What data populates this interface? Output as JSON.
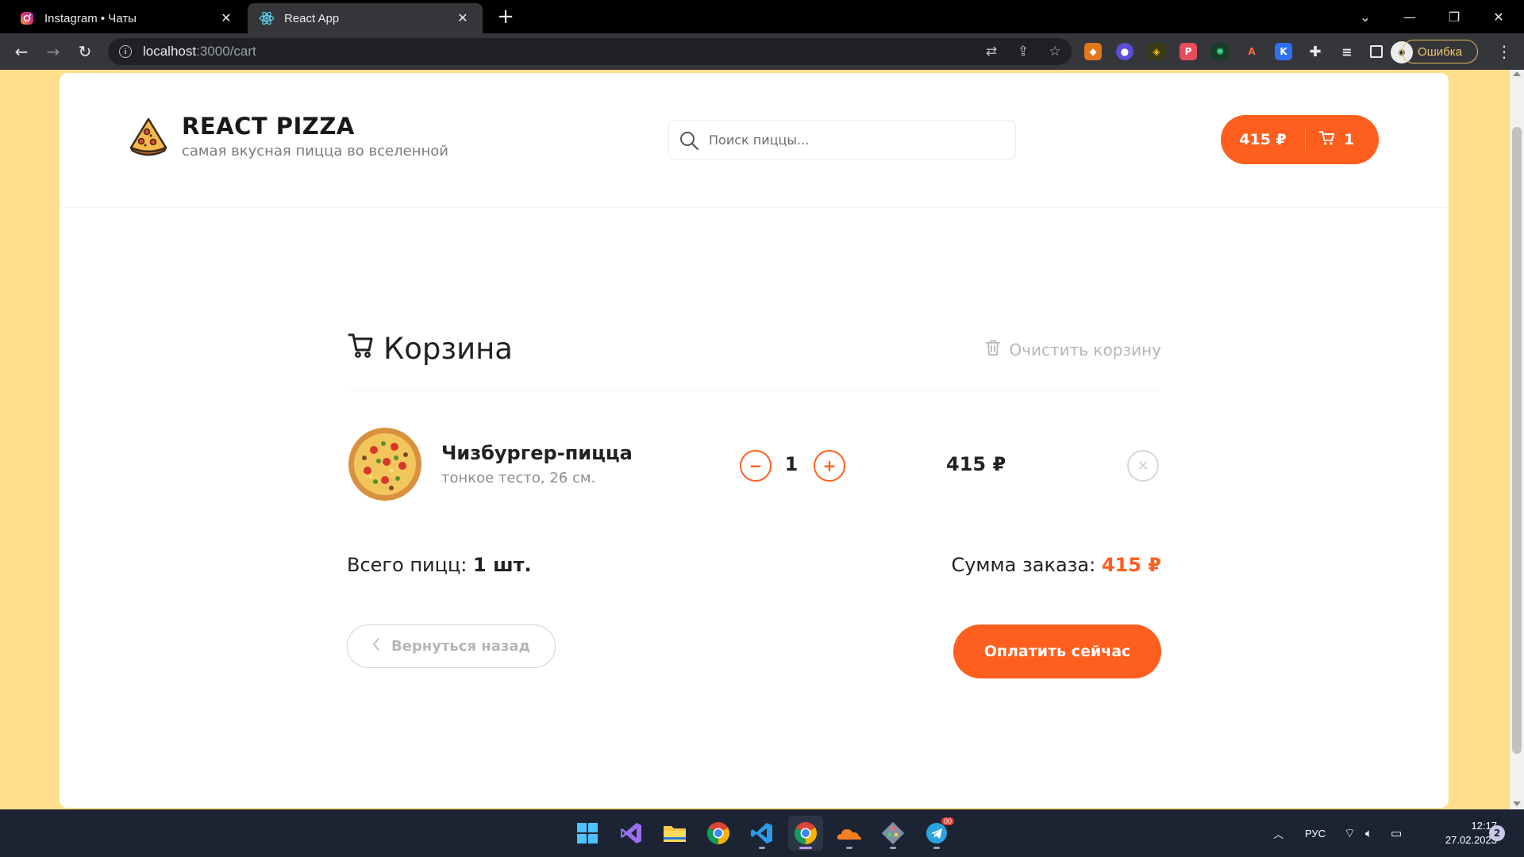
{
  "browser": {
    "tabs": [
      {
        "title": "Instagram • Чаты",
        "active": false
      },
      {
        "title": "React App",
        "active": true
      }
    ],
    "url_host": "localhost",
    "url_path": ":3000/cart",
    "error_label": "Ошибка"
  },
  "header": {
    "brand_name": "REACT PIZZA",
    "tagline": "самая вкусная пицца во вселенной",
    "search_placeholder": "Поиск пиццы...",
    "cart_total": "415 ₽",
    "cart_count": "1"
  },
  "cart": {
    "title": "Корзина",
    "clear_label": "Очистить корзину",
    "items": [
      {
        "name": "Чизбургер-пицца",
        "description": "тонкое тесто, 26 см.",
        "quantity": "1",
        "price": "415 ₽",
        "minus": "−",
        "plus": "+"
      }
    ],
    "total_count_label": "Всего пицц:",
    "total_count_value": "1 шт.",
    "total_sum_label": "Сумма заказа:",
    "total_sum_value": "415 ₽",
    "back_label": "Вернуться назад",
    "pay_label": "Оплатить сейчас"
  },
  "taskbar": {
    "language": "РУС",
    "time": "12:17",
    "date": "27.02.2023",
    "notifications": "2",
    "telegram_badge": "00"
  },
  "colors": {
    "accent": "#fe5f1e",
    "page_bg": "#ffdf8c"
  }
}
